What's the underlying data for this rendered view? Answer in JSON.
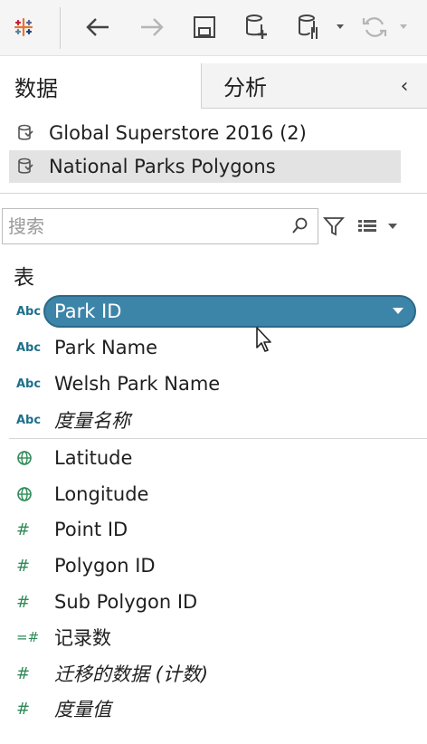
{
  "toolbar": {
    "icons": [
      "tableau-logo-icon",
      "back-arrow-icon",
      "forward-arrow-icon",
      "save-icon",
      "new-datasource-icon",
      "pause-updates-icon",
      "dropdown-caret-icon",
      "refresh-icon"
    ]
  },
  "tabs": {
    "data_label": "数据",
    "analysis_label": "分析"
  },
  "datasources": [
    {
      "label": "Global Superstore 2016 (2)"
    },
    {
      "label": "National Parks Polygons"
    }
  ],
  "search": {
    "placeholder": "搜索"
  },
  "section": {
    "label": "表"
  },
  "dimensions": [
    {
      "type_badge": "Abc",
      "label": "Park ID",
      "selected": true
    },
    {
      "type_badge": "Abc",
      "label": "Park Name"
    },
    {
      "type_badge": "Abc",
      "label": "Welsh Park Name"
    },
    {
      "type_badge": "Abc",
      "label": "度量名称"
    }
  ],
  "measures": [
    {
      "type_icon": "globe-icon",
      "label": "Latitude"
    },
    {
      "type_icon": "globe-icon",
      "label": "Longitude"
    },
    {
      "type_badge": "#",
      "label": "Point ID"
    },
    {
      "type_badge": "#",
      "label": "Polygon ID"
    },
    {
      "type_badge": "#",
      "label": "Sub Polygon ID"
    },
    {
      "type_badge": "=#",
      "label": "记录数"
    },
    {
      "type_badge": "#",
      "label": "迁移的数据 (计数)"
    },
    {
      "type_badge": "#",
      "label": "度量值"
    }
  ],
  "colors": {
    "pill_fill": "#3d85a8",
    "dimension_badge": "#1f6f8b",
    "measure_badge": "#2e8b57"
  }
}
